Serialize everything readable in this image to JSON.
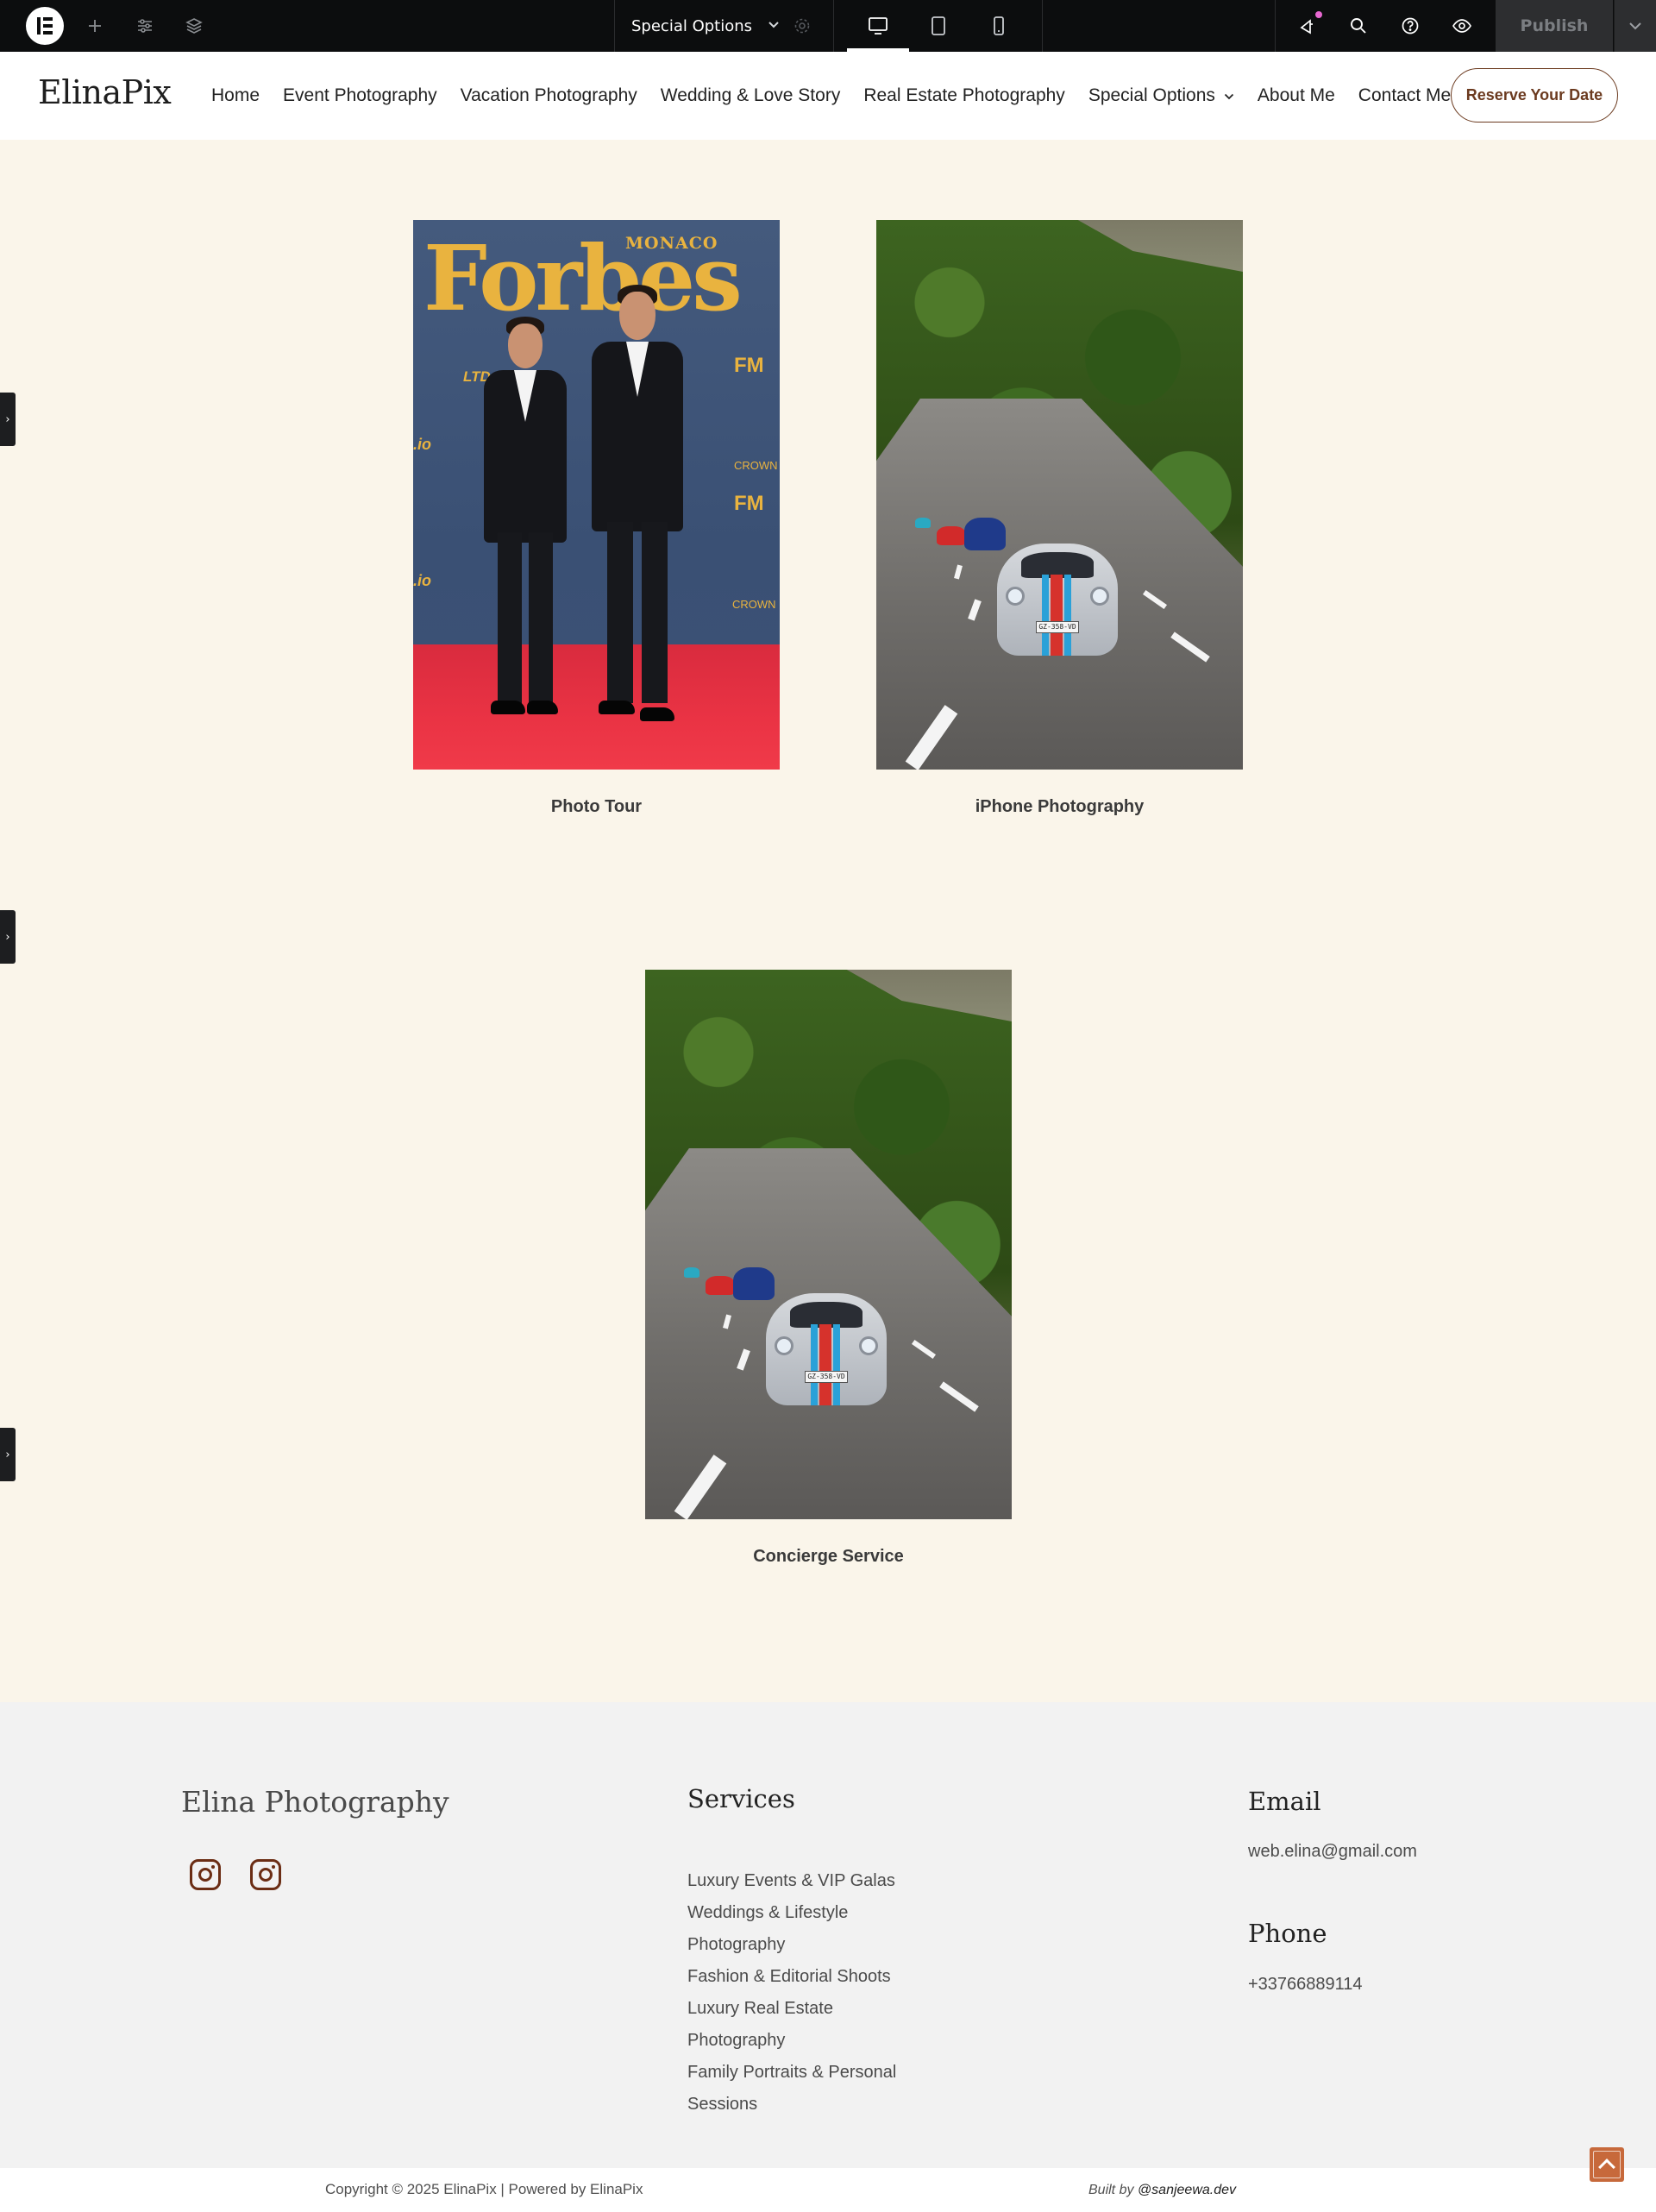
{
  "editor": {
    "page_name": "Special Options",
    "publish_label": "Publish",
    "tools": [
      "add-element-icon",
      "site-settings-icon",
      "structure-icon"
    ],
    "devices": [
      "desktop",
      "tablet",
      "mobile"
    ],
    "active_device": "desktop",
    "right_tools": [
      "whats-new-icon",
      "search-icon",
      "help-icon",
      "preview-icon"
    ]
  },
  "site": {
    "brand": "ElinaPix",
    "nav": [
      {
        "label": "Home"
      },
      {
        "label": "Event Photography"
      },
      {
        "label": "Vacation Photography"
      },
      {
        "label": "Wedding & Love Story"
      },
      {
        "label": "Real Estate Photography"
      },
      {
        "label": "Special Options",
        "has_dropdown": true
      },
      {
        "label": "About Me"
      },
      {
        "label": "Contact Me"
      }
    ],
    "cta": "Reserve Your Date"
  },
  "gallery": [
    {
      "caption": "Photo Tour",
      "image": "red-carpet-forbes-monaco"
    },
    {
      "caption": "iPhone Photography",
      "image": "sports-cars-mountain-road"
    },
    {
      "caption": "Concierge Service",
      "image": "sports-cars-mountain-road"
    }
  ],
  "photo_text": {
    "forbes": "Forbes",
    "monaco": "MONACO",
    "ltd": "LTD.INC",
    "io": ".io",
    "crown": "CROWN",
    "fm": "FM",
    "plate": "GZ-358-VD"
  },
  "footer": {
    "brand": "Elina Photography",
    "social": [
      "instagram-icon",
      "instagram-icon"
    ],
    "services_heading": "Services",
    "services": [
      "Luxury Events & VIP Galas",
      "Weddings & Lifestyle Photography",
      "Fashion & Editorial Shoots",
      "Luxury Real Estate Photography",
      "Family Portraits & Personal Sessions"
    ],
    "email_heading": "Email",
    "email": "web.elina@gmail.com",
    "phone_heading": "Phone",
    "phone": "+33766889114",
    "copyright": "Copyright © 2025 ElinaPix | Powered by ElinaPix",
    "built_by_prefix": "Built by",
    "built_by_name": "@sanjeewa.dev"
  },
  "colors": {
    "editor_bg": "#0c0d0e",
    "page_bg": "#faf5ea",
    "footer_bg": "#f2f2f2",
    "accent_brown": "#6b3a1f",
    "scroll_top": "#c7693b"
  }
}
